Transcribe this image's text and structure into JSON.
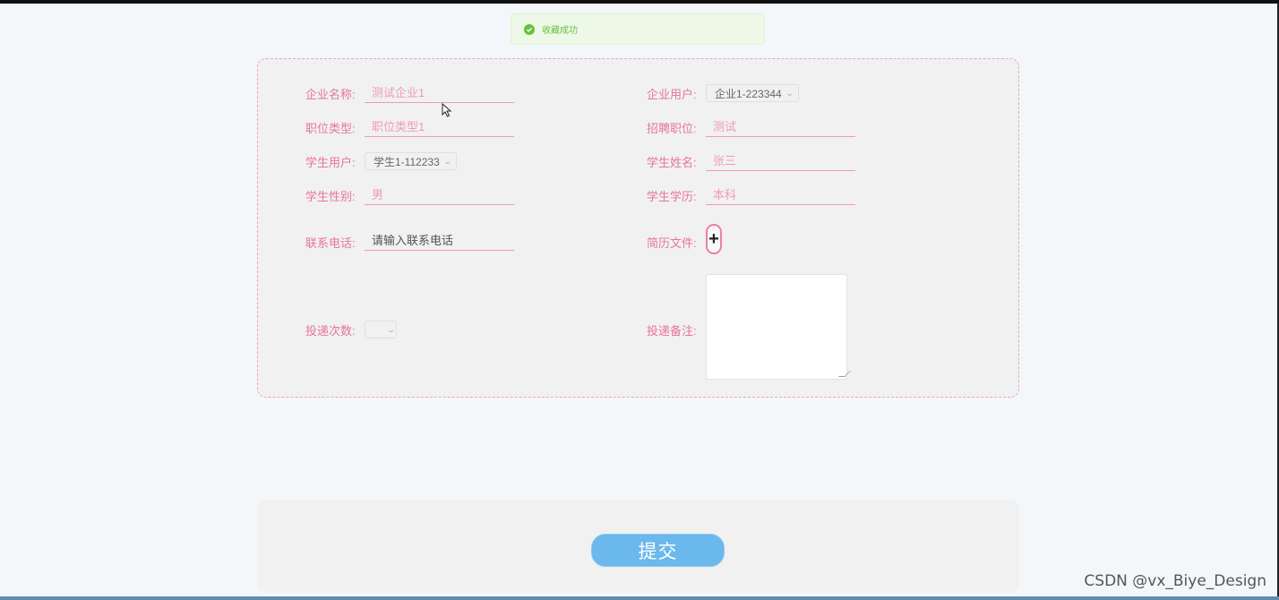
{
  "toast": {
    "message": "收藏成功"
  },
  "form": {
    "company_name": {
      "label": "企业名称:",
      "value": "测试企业1"
    },
    "company_user": {
      "label": "企业用户:",
      "value": "企业1-223344"
    },
    "job_type": {
      "label": "职位类型:",
      "value": "职位类型1"
    },
    "recruit_position": {
      "label": "招聘职位:",
      "value": "测试"
    },
    "student_user": {
      "label": "学生用户:",
      "value": "学生1-112233"
    },
    "student_name": {
      "label": "学生姓名:",
      "value": "张三"
    },
    "student_gender": {
      "label": "学生性别:",
      "value": "男"
    },
    "student_education": {
      "label": "学生学历:",
      "value": "本科"
    },
    "phone": {
      "label": "联系电话:",
      "value": "请输入联系电话"
    },
    "resume_file": {
      "label": "简历文件:"
    },
    "delivery_count": {
      "label": "投递次数:",
      "value": ""
    },
    "delivery_note": {
      "label": "投递备注:",
      "value": ""
    }
  },
  "submit": {
    "label": "提交"
  },
  "watermark": "CSDN @vx_Biye_Design",
  "colors": {
    "accent_pink": "#e8739f",
    "button_blue": "#6ab8ec",
    "success_green": "#67c23a"
  },
  "icons": {
    "toast": "check-circle-icon",
    "upload": "plus-icon",
    "select": "chevron-down-icon"
  }
}
